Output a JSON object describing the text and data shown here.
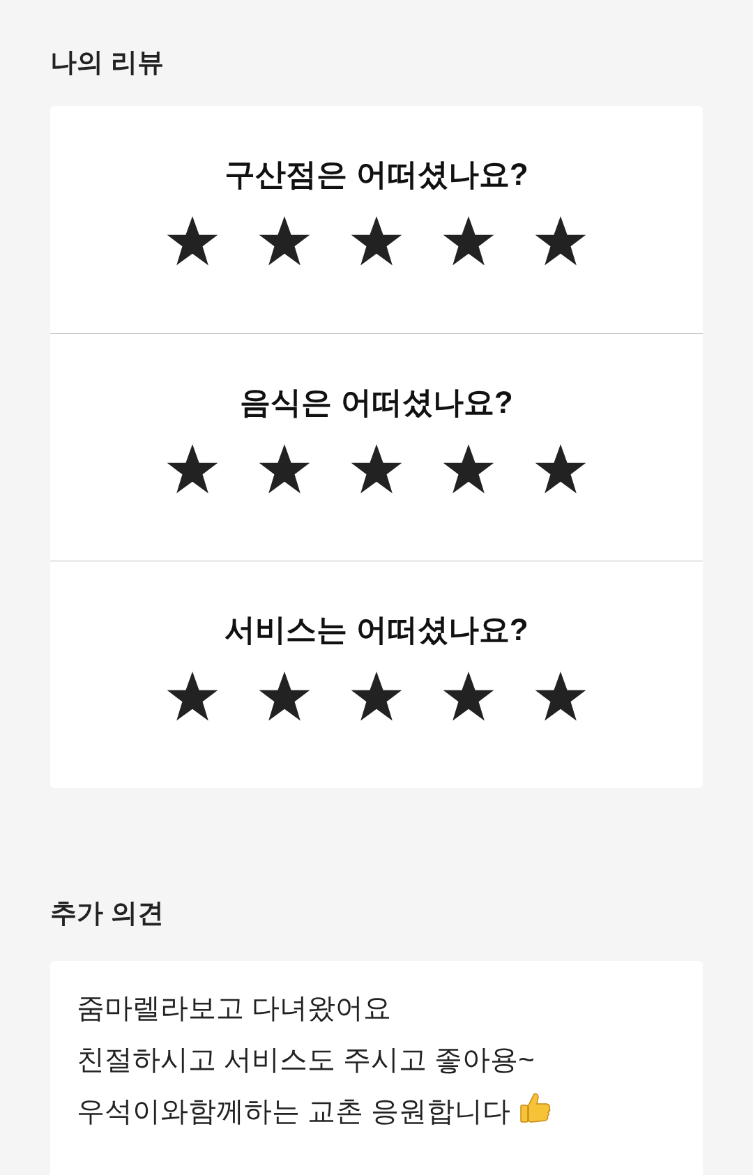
{
  "review_title": "나의 리뷰",
  "sections": [
    {
      "question": "구산점은 어떠셨나요?",
      "stars": 5
    },
    {
      "question": "음식은 어떠셨나요?",
      "stars": 5
    },
    {
      "question": "서비스는 어떠셨나요?",
      "stars": 5
    }
  ],
  "comment_title": "추가 의견",
  "comment_lines": [
    "줌마렐라보고 다녀왔어요",
    "친절하시고 서비스도 주시고 좋아용~",
    "우석이와함께하는 교촌 응원합니다"
  ]
}
